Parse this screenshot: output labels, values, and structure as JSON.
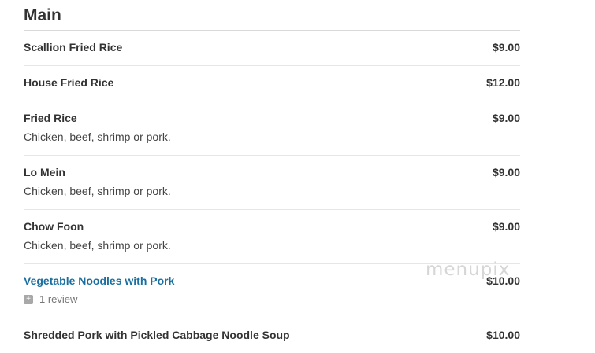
{
  "section": {
    "title": "Main"
  },
  "items": [
    {
      "name": "Scallion Fried Rice",
      "price": "$9.00"
    },
    {
      "name": "House Fried Rice",
      "price": "$12.00"
    },
    {
      "name": "Fried Rice",
      "price": "$9.00",
      "description": "Chicken, beef, shrimp or pork."
    },
    {
      "name": "Lo Mein",
      "price": "$9.00",
      "description": "Chicken, beef, shrimp or pork."
    },
    {
      "name": "Chow Foon",
      "price": "$9.00",
      "description": "Chicken, beef, shrimp or pork."
    },
    {
      "name": "Vegetable Noodles with Pork",
      "price": "$10.00",
      "review_icon": "plus-square-icon",
      "reviews": "1 review"
    },
    {
      "name": "Shredded Pork with Pickled Cabbage Noodle Soup",
      "price": "$10.00"
    }
  ],
  "watermark": {
    "text": "menupix"
  },
  "colors": {
    "link": "#1a6fa0",
    "text": "#333333",
    "divider": "#e6e6e6"
  }
}
